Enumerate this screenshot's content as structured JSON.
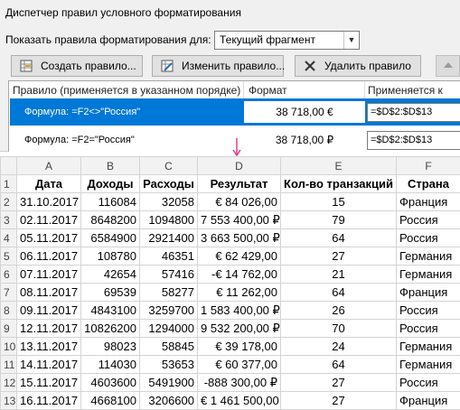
{
  "dialog": {
    "title": "Диспетчер правил условного форматирования",
    "show_label": "Показать правила форматирования для:",
    "scope_value": "Текущий фрагмент",
    "toolbar": {
      "new_rule": "Создать правило...",
      "edit_rule": "Изменить правило...",
      "delete_rule": "Удалить правило"
    },
    "rules_header": {
      "rule": "Правило (применяется в указанном порядке)",
      "format": "Формат",
      "applies_to": "Применяется к"
    },
    "rules": [
      {
        "formula": "Формула: =F2<>\"Россия\"",
        "format_preview": "38 718,00 €",
        "applies_to": "=$D$2:$D$13"
      },
      {
        "formula": "Формула: =F2=\"Россия\"",
        "format_preview": "38 718,00 ₽",
        "applies_to": "=$D$2:$D$13"
      }
    ]
  },
  "sheet": {
    "columns": [
      "A",
      "B",
      "C",
      "D",
      "E",
      "F"
    ],
    "header": [
      "Дата",
      "Доходы",
      "Расходы",
      "Результат",
      "Кол-во транзакций",
      "Страна"
    ],
    "rows": [
      [
        "2",
        "31.10.2017",
        "116084",
        "32058",
        "€ 84 026,00",
        "15",
        "Франция"
      ],
      [
        "3",
        "02.11.2017",
        "8648200",
        "1094800",
        "7 553 400,00 ₽",
        "79",
        "Россия"
      ],
      [
        "4",
        "05.11.2017",
        "6584900",
        "2921400",
        "3 663 500,00 ₽",
        "64",
        "Россия"
      ],
      [
        "5",
        "06.11.2017",
        "108780",
        "46351",
        "€ 62 429,00",
        "27",
        "Германия"
      ],
      [
        "6",
        "07.11.2017",
        "42654",
        "57416",
        "-€ 14 762,00",
        "21",
        "Германия"
      ],
      [
        "7",
        "08.11.2017",
        "69539",
        "58277",
        "€ 11 262,00",
        "64",
        "Франция"
      ],
      [
        "8",
        "09.11.2017",
        "4843100",
        "3259700",
        "1 583 400,00 ₽",
        "26",
        "Россия"
      ],
      [
        "9",
        "12.11.2017",
        "10826200",
        "1294000",
        "9 532 200,00 ₽",
        "70",
        "Россия"
      ],
      [
        "10",
        "13.11.2017",
        "98023",
        "58845",
        "€ 39 178,00",
        "24",
        "Германия"
      ],
      [
        "11",
        "14.11.2017",
        "114030",
        "53653",
        "€ 60 377,00",
        "64",
        "Германия"
      ],
      [
        "12",
        "15.11.2017",
        "4603600",
        "5491900",
        "-888 300,00 ₽",
        "27",
        "Россия"
      ],
      [
        "13",
        "16.11.2017",
        "4668100",
        "3206600",
        "€ 1 461 500,00",
        "27",
        "Франция"
      ]
    ]
  },
  "icons": {
    "new_rule": "new-rule-icon",
    "edit_rule": "edit-rule-icon",
    "delete_rule": "delete-x-icon",
    "move_up": "move-up-icon",
    "arrow": "pink-down-arrow-icon"
  },
  "colors": {
    "selection": "#0078d7",
    "arrow": "#e0408a"
  }
}
